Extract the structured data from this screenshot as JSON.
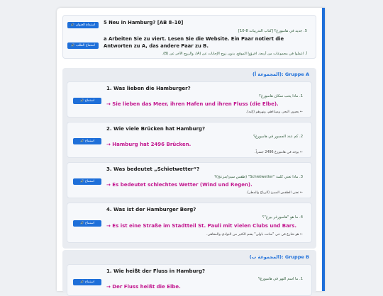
{
  "header": {
    "title": "5 Neu in Hamburg? [AB 8–10]",
    "title_ar": "5. جديد في هامبورغ؟ [كتاب التدريبات 8-10]",
    "listen_title_btn": "🔊 استماع العنوان",
    "listen_task_btn": "🔊 استماع الطلب",
    "instructions": "a Arbeiten Sie zu viert. Lesen Sie die Website. Ein Paar notiert die Antworten zu A, das andere Paar zu B.",
    "instructions_ar": "أ. اعملوا في مجموعات من أربعة. اقرؤوا الموقع. يدون زوج الإجابات عن (A)، والزوج الآخر عن (B)."
  },
  "groups": [
    {
      "title": "Gruppe A",
      "title_ar": "(المجموعة أ):",
      "questions": [
        {
          "button": "🔊 استماع",
          "question": "1. Was lieben die Hamburger?",
          "question_ar": "1. ماذا يحب سكان هامبورغ؟",
          "answer": "→ Sie lieben das Meer, ihren Hafen und ihren Fluss (die Elbe).",
          "answer_ar": "← يحبون البحر، وميناءهم، ونهرهم (إلبه)."
        },
        {
          "button": "🔊 استماع",
          "question": "2. Wie viele Brücken hat Hamburg?",
          "question_ar": "2. كم عدد الجسور في هامبورغ؟",
          "answer": "→ Hamburg hat 2496 Brücken.",
          "answer_ar": "← يوجد في هامبورغ 2496 جسراً."
        },
        {
          "button": "🔊 استماع",
          "question": "3. Was bedeutet „Schietwetter“?",
          "question_ar": "3. ماذا تعني كلمة \"Schietwetter\" (طقس سيئ/مزعج)؟",
          "answer": "→ Es bedeutet schlechtes Wetter (Wind und Regen).",
          "answer_ar": "← تعني الطقس السيئ (الرياح والمطر)."
        },
        {
          "button": "🔊 استماع",
          "question": "4. Was ist der Hamburger Berg?",
          "question_ar": "4. ما هو \"هامبورغر بيرغ\"؟",
          "answer": "→ Es ist eine Straße im Stadtteil St. Pauli mit vielen Clubs und Bars.",
          "answer_ar": "← هو شارع في حي \"سانت باولي\" يضم الكثير من النوادي والمقاهي."
        }
      ]
    },
    {
      "title": "Gruppe B",
      "title_ar": "(المجموعة ب):",
      "questions": [
        {
          "button": "🔊 استماع",
          "question": "1. Wie heißt der Fluss in Hamburg?",
          "question_ar": "1. ما اسم النهر في هامبورغ؟",
          "answer": "→ Der Fluss heißt die Elbe.",
          "answer_ar": ""
        }
      ]
    }
  ]
}
